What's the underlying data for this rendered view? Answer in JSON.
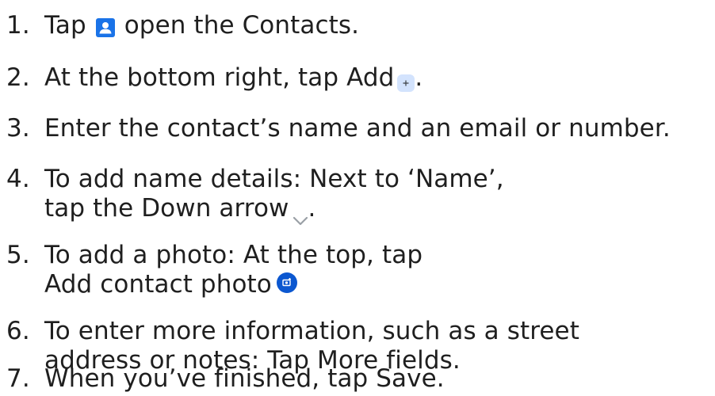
{
  "steps": [
    {
      "num": "1.",
      "text_before": "Tap",
      "text_after": "open the Contacts."
    },
    {
      "num": "2.",
      "text_before": "At the bottom right, tap Add",
      "text_after": "."
    },
    {
      "num": "3.",
      "text": "Enter the contact’s name and an email or number."
    },
    {
      "num": "4.",
      "line1": "To add name details: Next to ‘Name’,",
      "line2_before": "tap the Down arrow",
      "line2_after": "."
    },
    {
      "num": "5.",
      "line1": "To add a photo: At the top, tap",
      "line2": "Add contact photo"
    },
    {
      "num": "6.",
      "line1": "To enter more information, such as a street",
      "line2": "address or notes: Tap More fields."
    },
    {
      "num": "7.",
      "text": "When you’ve finished, tap Save."
    }
  ],
  "icons": {
    "contacts": "contacts-app-icon",
    "add": "add-icon",
    "down_arrow": "chevron-down-icon",
    "add_photo": "add-photo-icon"
  },
  "colors": {
    "text": "#1f1f1f",
    "contacts_icon": "#1a73e8",
    "add_bg": "#d3e3fd",
    "chevron": "#9aa0a6",
    "photo_bg": "#0b57d0"
  }
}
